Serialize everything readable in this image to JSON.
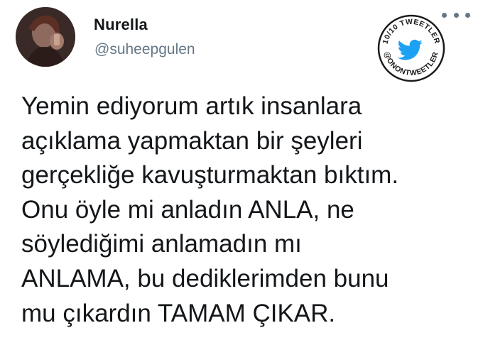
{
  "tweet": {
    "display_name": "Nurella",
    "handle": "@suheepgulen",
    "text_lines": [
      "Yemin ediyorum artık insanlara",
      "açıklama yapmaktan bir şeyleri",
      "gerçekliğe kavuşturmaktan bıktım.",
      "Onu öyle mi anladın ANLA, ne",
      "söylediğimi anlamadın mı",
      "ANLAMA, bu dediklerimden bunu",
      "mu çıkardın TAMAM ÇIKAR."
    ]
  },
  "badge": {
    "top_text": "10/10 TWEETLER",
    "bottom_text": "@ONONTWEETLER",
    "icon": "twitter-bird-icon",
    "bird_color": "#1da1f2"
  },
  "icons": {
    "more": "more-options-icon",
    "avatar": "avatar-photo"
  },
  "colors": {
    "name": "#14171a",
    "handle": "#657786",
    "text": "#14171a"
  }
}
